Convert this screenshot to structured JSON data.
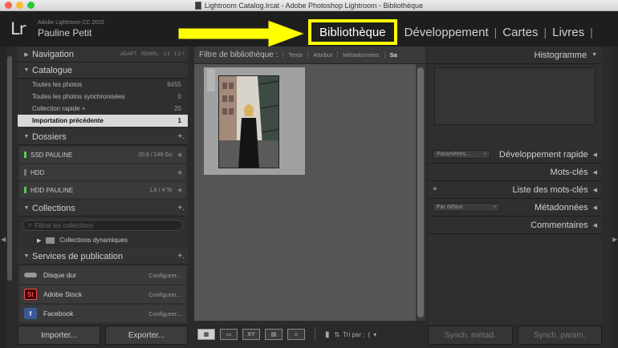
{
  "window": {
    "title": "Lightroom Catalog.lrcat - Adobe Photoshop Lightroom - Bibliothèque"
  },
  "header": {
    "logo": "Lr",
    "product": "Adobe Lightroom CC 2015",
    "user": "Pauline Petit",
    "modules": [
      {
        "label": "Bibliothèque",
        "active": true
      },
      {
        "label": "Développement"
      },
      {
        "label": "Cartes"
      },
      {
        "label": "Livres"
      }
    ],
    "separator": "|",
    "highlight_color": "#ffff00"
  },
  "left": {
    "navigation": {
      "label": "Navigation",
      "options": [
        "ADAPT.",
        "REMPL.",
        "1:1",
        "1:2 ÷"
      ]
    },
    "catalogue": {
      "label": "Catalogue",
      "items": [
        {
          "label": "Toutes les photos",
          "count": "8455"
        },
        {
          "label": "Toutes les photos synchronisées",
          "count": "0"
        },
        {
          "label": "Collection rapide +",
          "count": "20"
        },
        {
          "label": "Importation précédente",
          "count": "1"
        }
      ]
    },
    "dossiers": {
      "label": "Dossiers",
      "plus": "+.",
      "drives": [
        {
          "label": "SSD PAULINE",
          "size": "20,9 / 249 Go",
          "active": true
        },
        {
          "label": "HDD",
          "size": "",
          "active": false
        },
        {
          "label": "HDD PAULINE",
          "size": "1,6 / 4 To",
          "active": true
        }
      ]
    },
    "collections": {
      "label": "Collections",
      "plus": "+.",
      "filter_placeholder": "Filtrer les collections",
      "items": [
        {
          "label": "Collections dynamiques"
        }
      ]
    },
    "services": {
      "label": "Services de publication",
      "plus": "+.",
      "items": [
        {
          "label": "Disque dur",
          "action": "Configurer..."
        },
        {
          "label": "Adobe Stock",
          "action": "Configurer...",
          "badge": "St"
        },
        {
          "label": "Facebook",
          "action": "Configurer...",
          "badge": "f"
        }
      ]
    },
    "buttons": {
      "import": "Importer...",
      "export": "Exporter..."
    }
  },
  "center": {
    "filter": {
      "label": "Filtre de bibliothèque :",
      "options": [
        "Texte",
        "Attribut",
        "Métadonnées",
        "Sa"
      ]
    },
    "toolbar": {
      "sort_label": "Tri par :",
      "sort_value": "("
    }
  },
  "right": {
    "histogram": "Histogramme",
    "quick_develop": {
      "label": "Développement rapide",
      "preset": "Paramètres..."
    },
    "keywords": "Mots-clés",
    "keyword_list": "Liste des mots-clés",
    "metadata": {
      "label": "Métadonnées",
      "preset": "Par défaut"
    },
    "comments": "Commentaires",
    "buttons": {
      "sync_meta": "Synch. métad.",
      "sync_settings": "Synch. param."
    }
  }
}
